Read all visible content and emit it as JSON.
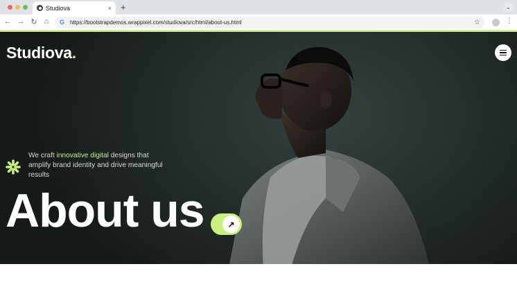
{
  "browser": {
    "tab_title": "Studiova",
    "tab_close": "×",
    "new_tab": "+",
    "tab_menu": "⌄",
    "url": "https://bootstrapdemos.wrappixel.com/studiova/src/html/about-us.html",
    "back": "←",
    "forward": "→",
    "reload": "↻",
    "home": "⌂",
    "bookmark": "☆",
    "menu": "⋮",
    "search_engine_glyph": "G"
  },
  "site": {
    "logo_text": "Studiova",
    "logo_dot": ".",
    "accent_color": "#c7f17c",
    "tagline_before": "We craft ",
    "tagline_highlight": "innovative digital",
    "tagline_after": " designs that amplify brand identity and drive meaningful results",
    "page_heading": "About us",
    "cta_icon": "↗"
  },
  "icons": {
    "menu": "hamburger-icon",
    "decor": "asterisk-icon",
    "cta": "arrow-up-right-icon"
  }
}
